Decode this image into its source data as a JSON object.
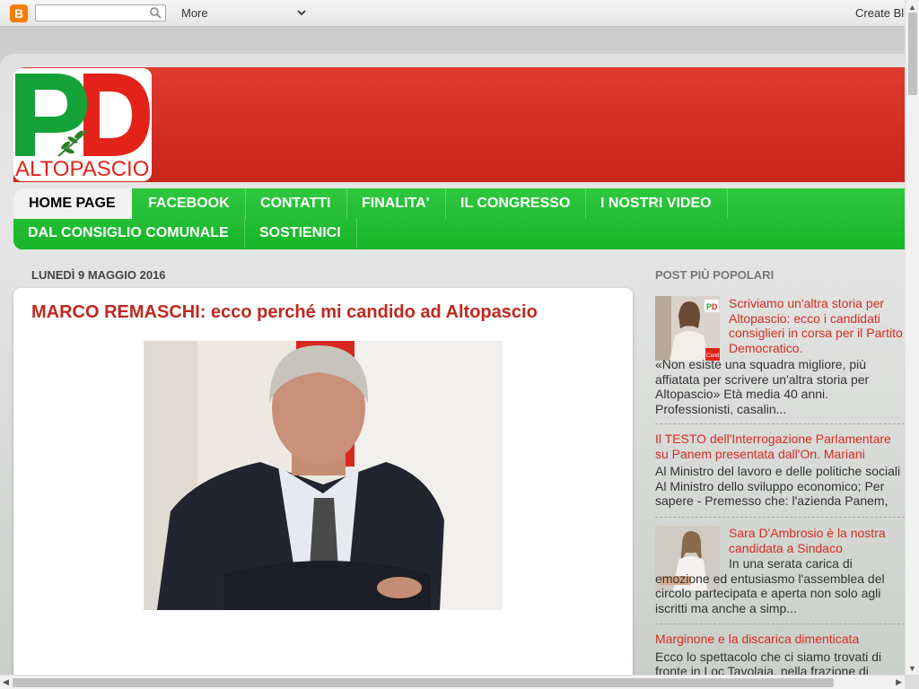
{
  "navbar": {
    "search_placeholder": "",
    "more_label": "More",
    "create_label": "Create Blo"
  },
  "logo": {
    "letters": "PD",
    "text": "ALTOPASCIO"
  },
  "colors": {
    "header_red": "#c9241a",
    "nav_green": "#1bbd2d",
    "link_red": "#d52c1f"
  },
  "nav": {
    "row1": [
      "HOME PAGE",
      "FACEBOOK",
      "CONTATTI",
      "FINALITA'",
      "IL CONGRESSO",
      "I NOSTRI VIDEO"
    ],
    "row2": [
      "DAL CONSIGLIO COMUNALE",
      "SOSTIENICI"
    ]
  },
  "main": {
    "date": "LUNEDÌ 9 MAGGIO 2016",
    "post_title": "MARCO REMASCHI: ecco perché mi candido ad Altopascio"
  },
  "sidebar": {
    "title": "POST PIÙ POPOLARI",
    "posts": [
      {
        "title": "Scriviamo un'altra storia per Altopascio: ecco i candidati consiglieri in corsa per il Partito Democratico.",
        "snippet": "«Non esiste una squadra migliore, più affiatata per scrivere un'altra storia per Altopascio» Età media 40 anni. Professionisti, casalin...",
        "thumb_badge": "Cand"
      },
      {
        "title": "Il TESTO dell'Interrogazione Parlamentare su Panem presentata dall'On. Mariani",
        "snippet": "Al Ministro del lavoro e delle politiche sociali Al Ministro dello sviluppo economico; Per sapere - Premesso che: l'azienda Panem, che occ..."
      },
      {
        "title": "Sara D'Ambrosio è la nostra candidata a Sindaco",
        "snippet": "In una serata carica di emozione ed entusiasmo l'assemblea del circolo partecipata e aperta non solo agli iscritti ma anche a simp..."
      },
      {
        "title": "Marginone e la discarica dimenticata",
        "snippet": "Ecco lo spettacolo che ci siamo trovati di fronte in Loc Tavolaia, nella frazione di Marginone. U"
      }
    ]
  }
}
